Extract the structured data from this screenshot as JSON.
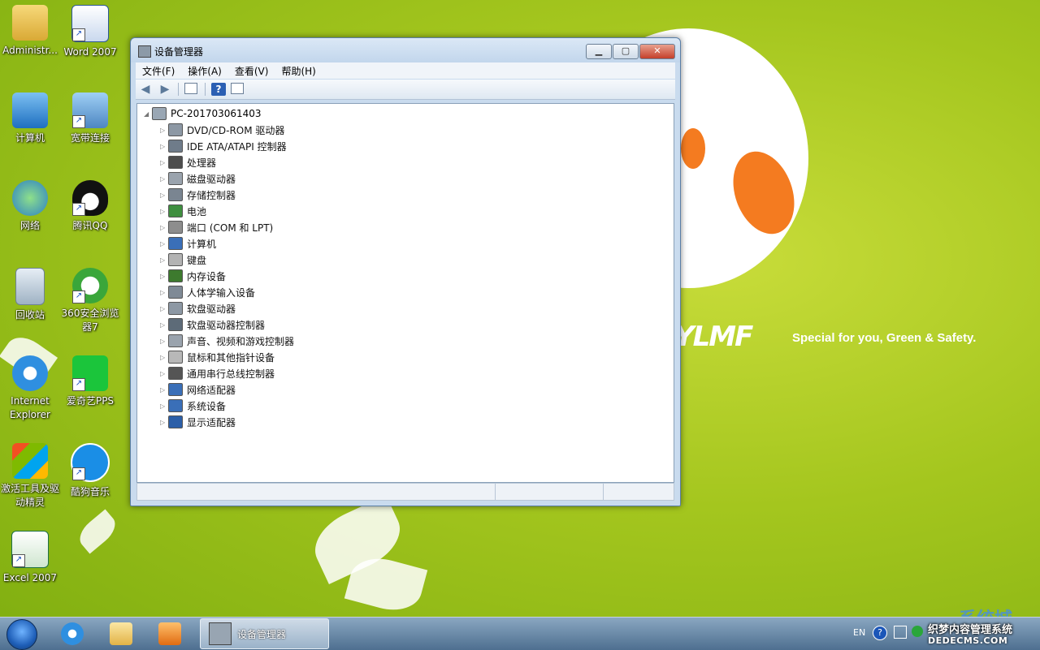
{
  "wallpaper": {
    "logo": "YLMF",
    "slogan": "Special for you, Green & Safety.",
    "corner_mark": "系统城"
  },
  "desktop_icons": [
    {
      "label": "Administr...",
      "icon": "user-folder-icon"
    },
    {
      "label": "Word 2007",
      "icon": "word-icon"
    },
    {
      "label": "计算机",
      "icon": "computer-icon"
    },
    {
      "label": "宽带连接",
      "icon": "broadband-icon"
    },
    {
      "label": "网络",
      "icon": "network-icon"
    },
    {
      "label": "腾讯QQ",
      "icon": "qq-icon"
    },
    {
      "label": "回收站",
      "icon": "recycle-bin-icon"
    },
    {
      "label": "360安全浏览器7",
      "icon": "360-browser-icon"
    },
    {
      "label": "Internet Explorer",
      "icon": "ie-icon"
    },
    {
      "label": "爱奇艺PPS",
      "icon": "iqiyi-icon"
    },
    {
      "label": "激活工具及驱动精灵",
      "icon": "activation-icon"
    },
    {
      "label": "酷狗音乐",
      "icon": "kugou-icon"
    },
    {
      "label": "Excel 2007",
      "icon": "excel-icon"
    }
  ],
  "window": {
    "title": "设备管理器",
    "buttons": {
      "minimize": "▁",
      "maximize": "▢",
      "close": "✕"
    },
    "menu": [
      "文件(F)",
      "操作(A)",
      "查看(V)",
      "帮助(H)"
    ],
    "toolbar": [
      "back-icon",
      "forward-icon",
      "show-hide-tree-icon",
      "help-icon",
      "properties-icon"
    ],
    "root": "PC-201703061403",
    "devices": [
      "DVD/CD-ROM 驱动器",
      "IDE ATA/ATAPI 控制器",
      "处理器",
      "磁盘驱动器",
      "存储控制器",
      "电池",
      "端口 (COM 和 LPT)",
      "计算机",
      "键盘",
      "内存设备",
      "人体学输入设备",
      "软盘驱动器",
      "软盘驱动器控制器",
      "声音、视频和游戏控制器",
      "鼠标和其他指针设备",
      "通用串行总线控制器",
      "网络适配器",
      "系统设备",
      "显示适配器"
    ]
  },
  "taskbar": {
    "active_window": "设备管理器",
    "tray": {
      "language": "EN",
      "help": "?",
      "watermark_line1": "织梦内容管理系统",
      "watermark_line2": "DEDECMS.COM"
    }
  }
}
